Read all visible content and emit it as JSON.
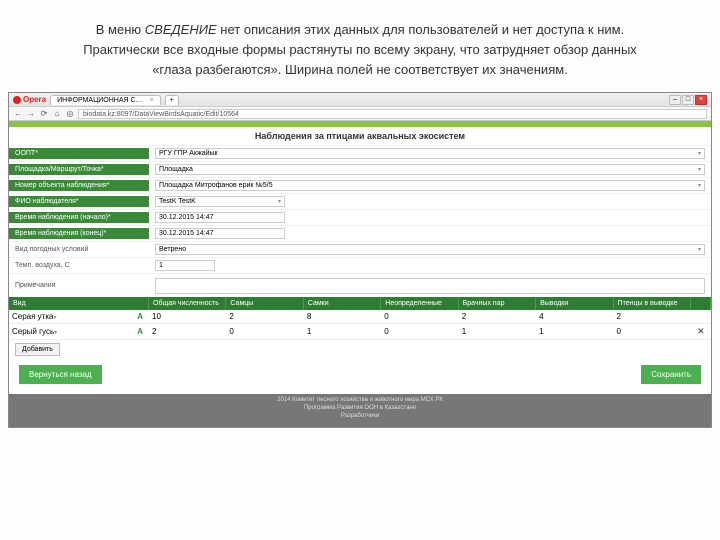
{
  "slide": {
    "line1a": "В меню ",
    "line1_italic": "СВЕДЕНИЕ ",
    "line1b": " нет описания этих данных  для пользователей и нет доступа к ним.",
    "line2": "Практически все входные формы растянуты по всему экрану, что затрудняет обзор данных",
    "line3": "«глаза разбегаются». Ширина полей  не соответствует их значениям."
  },
  "browser": {
    "brand": "Opera",
    "tab_title": "ИНФОРМАЦИОННАЯ С…",
    "tab_plus": "+",
    "url": "biodata.kz:8097/DataViewBirdsAquatic/Edit/10564"
  },
  "page": {
    "title": "Наблюдения за птицами аквальных экосистем"
  },
  "form": {
    "rows": [
      {
        "label": "ООПТ*",
        "value": "РГУ ГПР Акжайык",
        "type": "select",
        "w": "full"
      },
      {
        "label": "Площадка/Маршрут/Точка*",
        "value": "Площадка",
        "type": "select",
        "w": "full"
      },
      {
        "label": "Номер объекта наблюдения*",
        "value": "Площадка Митрофанов ерик №5/5",
        "type": "select",
        "w": "full"
      },
      {
        "label": "ФИО наблюдателя*",
        "value": "TestK TestK",
        "type": "select",
        "w": "short"
      },
      {
        "label": "Время наблюдения (начало)*",
        "value": "30.12.2015 14:47",
        "type": "text",
        "w": "short"
      },
      {
        "label": "Время наблюдения (конец)*",
        "value": "30.12.2015 14:47",
        "type": "text",
        "w": "short"
      },
      {
        "label": "Вид погодных условий",
        "value": "Ветрено",
        "type": "select",
        "w": "full"
      },
      {
        "label": "Темп. воздуха, C",
        "value": "1",
        "type": "text",
        "w": "tiny"
      },
      {
        "label": "Примечания",
        "value": "",
        "type": "text",
        "w": "full"
      }
    ]
  },
  "table": {
    "headers": {
      "species": "Вид",
      "total": "Общая численность",
      "males": "Самцы",
      "females": "Самки",
      "undef": "Неопределенные",
      "pairs": "Брачных пар",
      "broods": "Выводки",
      "chicks": "Птенцы в выводке"
    },
    "rows": [
      {
        "species": "Серая утка",
        "total": "10",
        "males": "2",
        "females": "8",
        "undef": "0",
        "pairs": "2",
        "broods": "4",
        "chicks": "2"
      },
      {
        "species": "Серый гусь",
        "total": "2",
        "males": "0",
        "females": "1",
        "undef": "0",
        "pairs": "1",
        "broods": "1",
        "chicks": "0"
      }
    ],
    "add_label": "Добавить"
  },
  "buttons": {
    "back": "Вернуться назад",
    "save": "Сохранить"
  },
  "footer": {
    "l1": "2014 Комитет лесного хозяйства и животного мира МСХ РК",
    "l2": "Программа Развития ООН в Казахстане",
    "l3": "Разработчики"
  }
}
